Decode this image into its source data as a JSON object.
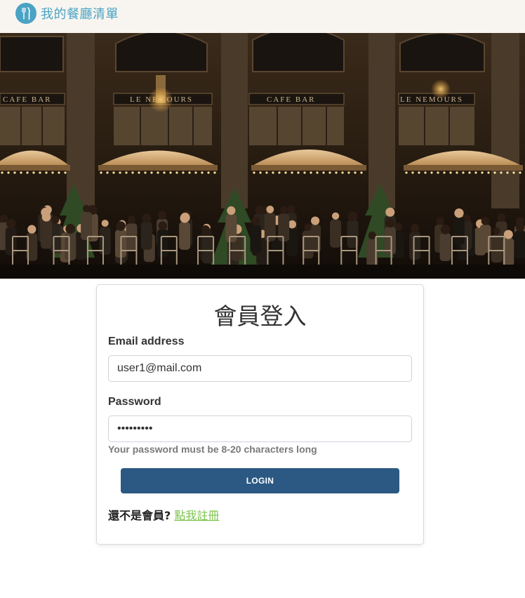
{
  "navbar": {
    "brand": "我的餐廳清單",
    "brand_color": "#4aa3c4",
    "brand_icon": "utensils-icon"
  },
  "banner": {
    "signs": [
      "CAFE BAR",
      "LE NEMOURS",
      "CAFE BAR",
      "LE NEMOURS"
    ]
  },
  "login": {
    "title": "會員登入",
    "email_label": "Email address",
    "email_value": "user1@mail.com",
    "password_label": "Password",
    "password_value": "123456789",
    "password_hint": "Your password must be 8-20 characters long",
    "button_label": "LOGIN",
    "button_color": "#2b5983",
    "signup_prompt": "還不是會員?",
    "signup_link": "點我註冊",
    "link_color": "#7bc44a"
  }
}
